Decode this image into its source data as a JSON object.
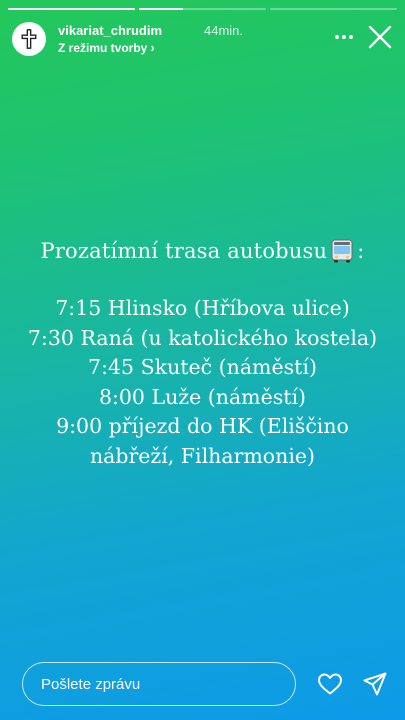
{
  "story": {
    "progress": [
      1.0,
      0.35,
      0.0
    ]
  },
  "header": {
    "username": "vikariat_chrudim",
    "timestamp": "44min.",
    "subtitle": "Z režimu tvorby",
    "subtitle_chevron": "›",
    "avatar_icon": "cross-icon",
    "more_icon": "more-dots-icon",
    "close_icon": "close-icon"
  },
  "content": {
    "title": "Prozatímní trasa autobusu",
    "title_suffix": ":",
    "title_emoji": "bus-icon",
    "stops": [
      "7:15 Hlinsko (Hříbova ulice)",
      "7:30 Raná (u katolického kostela)",
      "7:45 Skuteč (náměstí)",
      "8:00 Luže (náměstí)",
      "9:00 příjezd do HK (Eliščino",
      "nábřeží, Filharmonie)"
    ]
  },
  "footer": {
    "message_placeholder": "Pošlete zprávu",
    "like_icon": "heart-icon",
    "send_icon": "send-icon"
  }
}
